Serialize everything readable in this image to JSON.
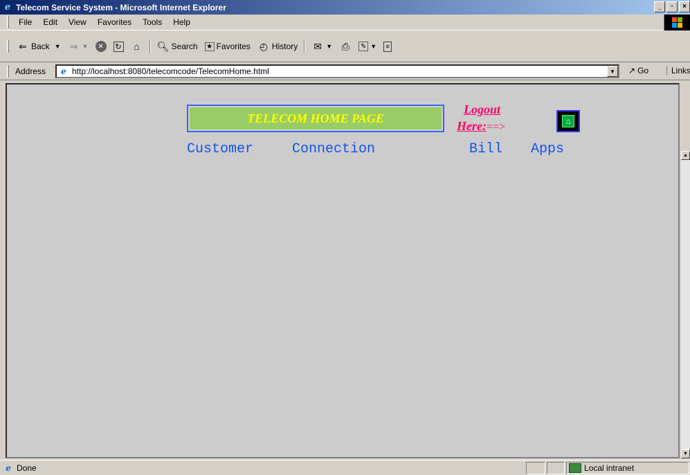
{
  "window": {
    "title": "Telecom Service System - Microsoft Internet Explorer",
    "controls": [
      "_",
      "▫",
      "×"
    ]
  },
  "menu": {
    "items": [
      "File",
      "Edit",
      "View",
      "Favorites",
      "Tools",
      "Help"
    ]
  },
  "toolbar": {
    "back_label": "Back",
    "search_label": "Search",
    "favorites_label": "Favorites",
    "history_label": "History"
  },
  "address": {
    "label": "Address",
    "url": "http://localhost:8080/telecomcode/TelecomHome.html",
    "go_label": "Go",
    "links_label": "Links"
  },
  "page": {
    "title": "TELECOM HOME PAGE",
    "logout_line1": "Logout",
    "logout_line2": "Here:",
    "logout_arrow": "==>",
    "nav": [
      "Customer",
      "Connection",
      "Bill",
      "Apps"
    ]
  },
  "status": {
    "text": "Done",
    "zone": "Local intranet"
  },
  "colors": {
    "title_bar_start": "#0a246a",
    "page_background": "#cccccc",
    "title_box_fill": "#99cc66",
    "title_text": "#ffff00",
    "logout_text": "#ff0066",
    "nav_text": "#1155ee"
  }
}
